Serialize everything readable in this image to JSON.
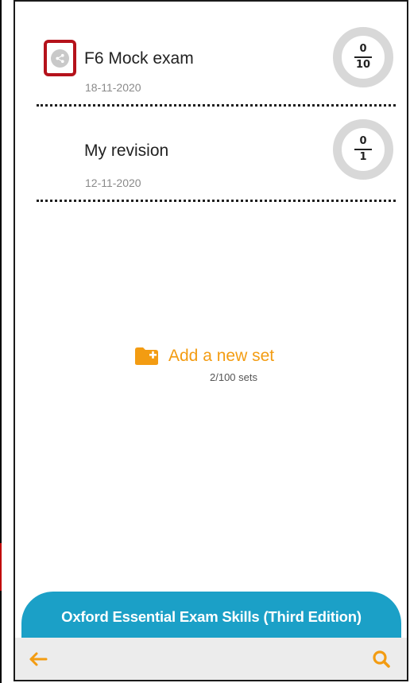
{
  "sets": [
    {
      "title": "F6 Mock exam",
      "date": "18-11-2020",
      "score": "0",
      "total": "10",
      "shared": true
    },
    {
      "title": "My revision",
      "date": "12-11-2020",
      "score": "0",
      "total": "1",
      "shared": false
    }
  ],
  "add_set": {
    "label": "Add a new set",
    "count": "2/100 sets"
  },
  "banner": {
    "title": "Oxford Essential Exam Skills (Third Edition)"
  },
  "icons": {
    "share": "share-icon",
    "add_folder": "folder-add-icon",
    "back": "arrow-left-icon",
    "search": "search-icon"
  },
  "colors": {
    "accent_orange": "#f39c12",
    "banner_blue": "#1ba0c7",
    "highlight_red": "#b5121b",
    "ring_gray": "#d8d8d8"
  }
}
